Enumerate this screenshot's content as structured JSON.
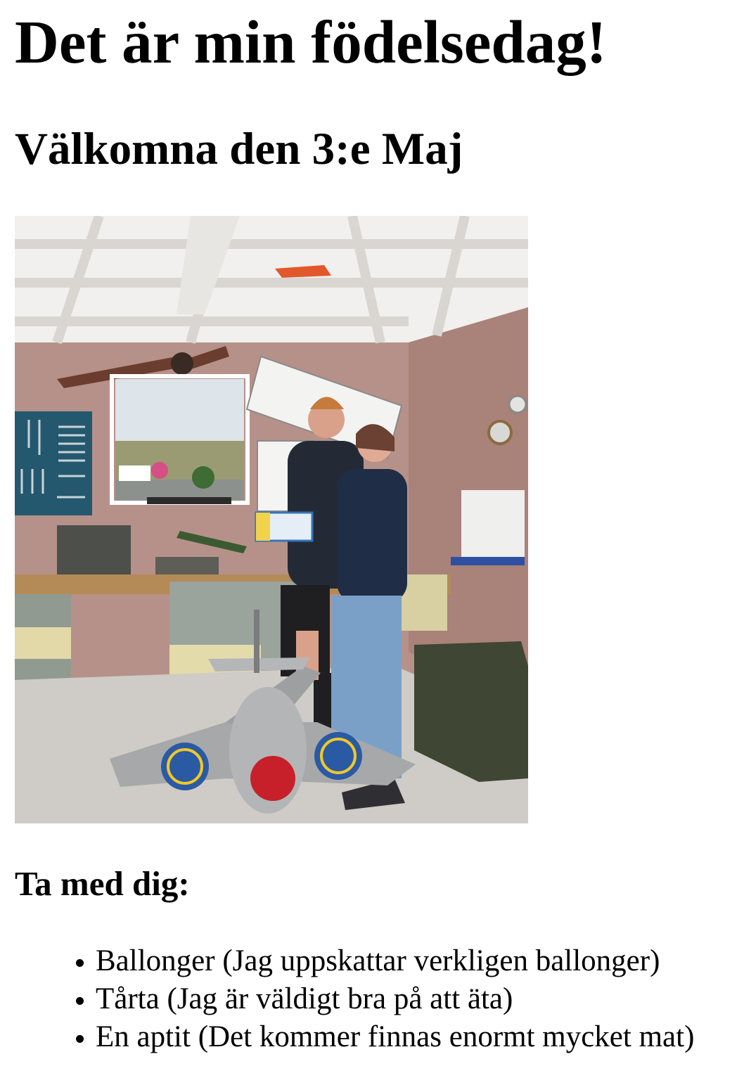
{
  "page": {
    "title": "Det är min födelsedag!",
    "subtitle": "Välkomna den 3:e Maj",
    "photo": {
      "subject": "photo"
    },
    "bring_heading": "Ta med dig:",
    "bring_items": [
      {
        "label": "Ballonger (Jag uppskattar verkligen ballonger)"
      },
      {
        "label": "Tårta (Jag är väldigt bra på att äta)"
      },
      {
        "label": "En aptit (Det kommer finnas enormt mycket mat)"
      }
    ]
  },
  "colors": {
    "text": "#000000",
    "background": "#ffffff"
  }
}
